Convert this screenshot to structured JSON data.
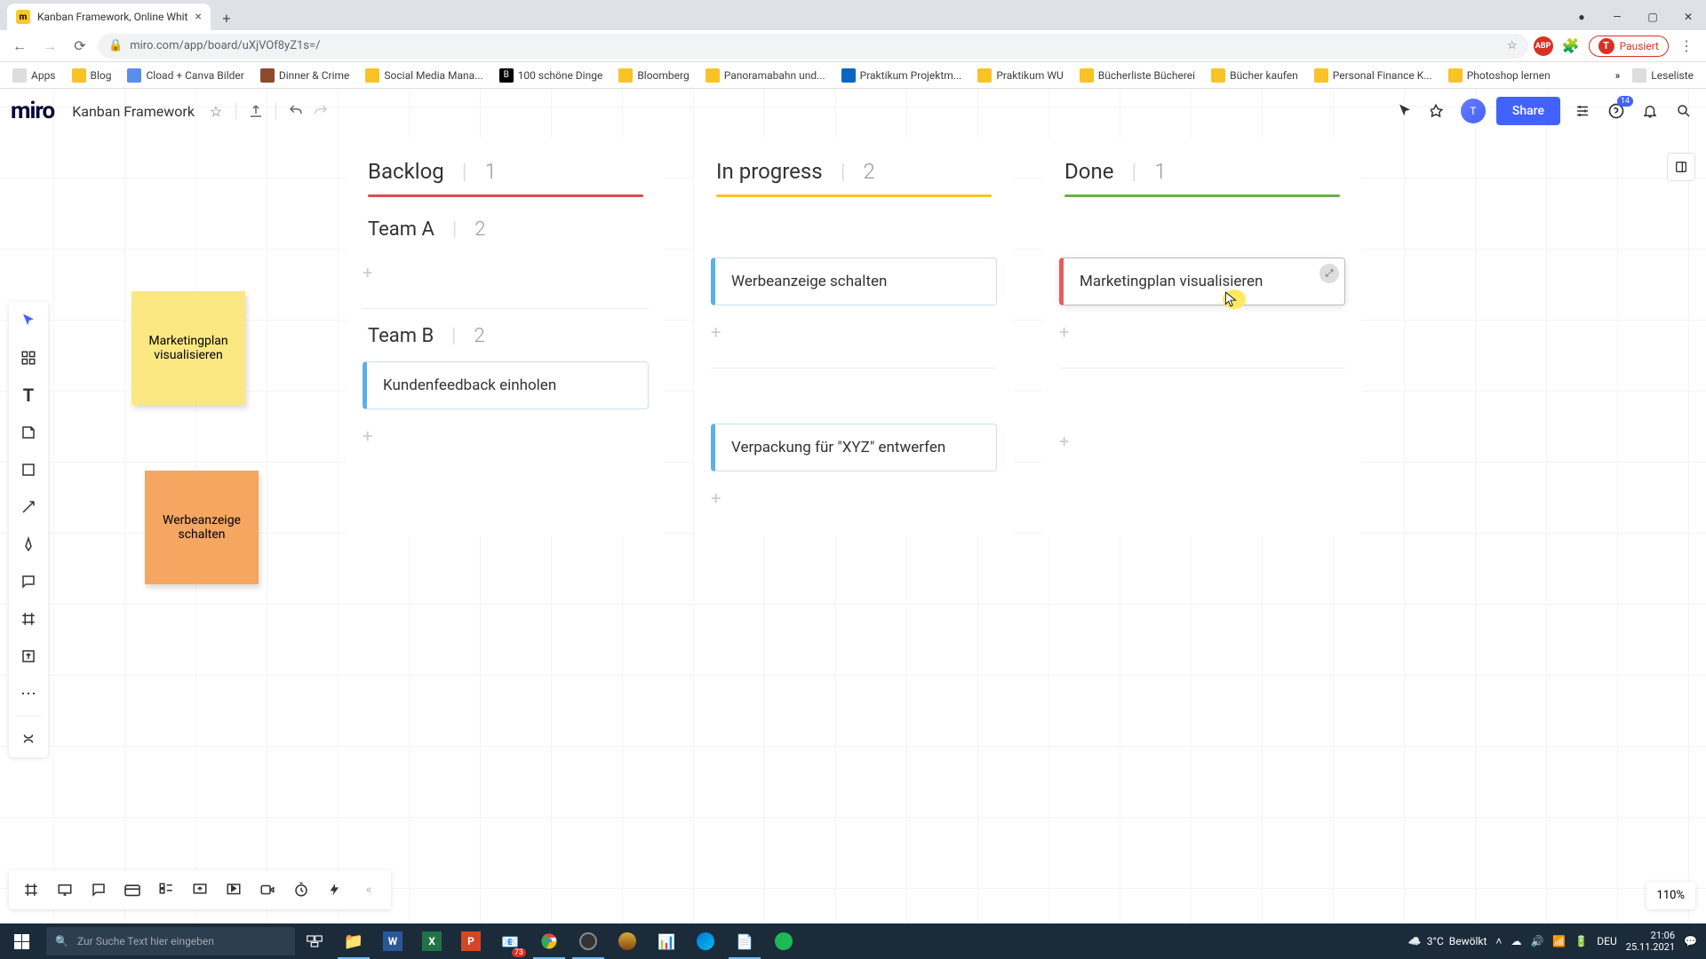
{
  "browser": {
    "tab_title": "Kanban Framework, Online Whit",
    "url": "miro.com/app/board/uXjVOf8yZ1s=/",
    "bookmarks_bar": [
      "Apps",
      "Blog",
      "Cload + Canva Bilder",
      "Dinner & Crime",
      "Social Media Mana...",
      "100 schöne Dinge",
      "Bloomberg",
      "Panoramabahn und...",
      "Praktikum Projektm...",
      "Praktikum WU",
      "Bücherliste Bücherei",
      "Bücher kaufen",
      "Personal Finance K...",
      "Photoshop lernen"
    ],
    "reading_list": "Leseliste",
    "paused_label": "Pausiert",
    "profile_initial": "T"
  },
  "app_header": {
    "logo": "miro",
    "board_name": "Kanban Framework",
    "share_label": "Share",
    "notif_count": "14"
  },
  "stickies": {
    "yellow": "Marketingplan visualisieren",
    "orange": "Werbeanzeige schalten"
  },
  "kanban": {
    "cols": [
      {
        "title": "Backlog",
        "count": "1",
        "color": "red"
      },
      {
        "title": "In progress",
        "count": "2",
        "color": "yellow"
      },
      {
        "title": "Done",
        "count": "1",
        "color": "green"
      }
    ],
    "swimlanes": [
      {
        "name": "Team A",
        "count": "2"
      },
      {
        "name": "Team B",
        "count": "2"
      }
    ],
    "cards": {
      "teamA_inprogress": "Werbeanzeige schalten",
      "teamA_done": "Marketingplan visualisieren",
      "teamB_backlog": "Kundenfeedback einholen",
      "teamB_inprogress": "Verpackung für \"XYZ\" entwerfen"
    }
  },
  "zoom": "110%",
  "taskbar": {
    "search_placeholder": "Zur Suche Text hier eingeben",
    "weather_temp": "3°C",
    "weather_cond": "Bewölkt",
    "lang": "DEU",
    "time": "21:06",
    "date": "25.11.2021",
    "chrome_badge": "73"
  }
}
